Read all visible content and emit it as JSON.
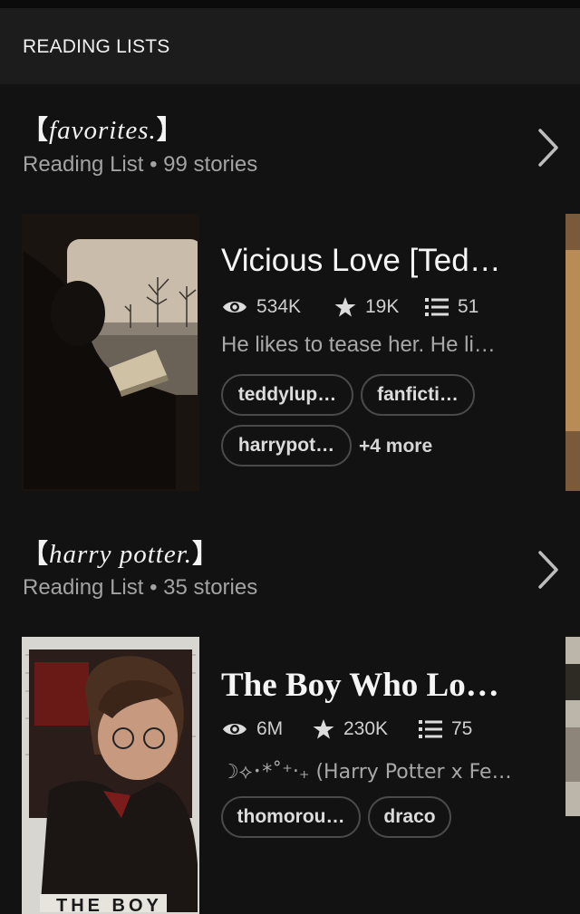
{
  "header": {
    "title": "READING LISTS"
  },
  "lists": [
    {
      "title_text": "favorites.",
      "title_open": "【",
      "title_close": "】",
      "meta": "Reading List • 99 stories",
      "story": {
        "title": "Vicious Love [Ted…",
        "views": "534K",
        "votes": "19K",
        "parts": "51",
        "description": "He likes to tease her. He li…",
        "tags": [
          "teddylup…",
          "fanficti…",
          "harrypot…"
        ],
        "more": "+4 more"
      }
    },
    {
      "title_text": "harry potter.",
      "title_open": "【",
      "title_close": "】",
      "meta": "Reading List • 35 stories",
      "story": {
        "title": "The Boy Who Lo…",
        "views": "6M",
        "votes": "230K",
        "parts": "75",
        "description": "☽⟡･*˚⁺‧₊ (Harry Potter x Fe…",
        "tags": [
          "thomorou…",
          "draco"
        ],
        "cover_text": "THE BOY"
      }
    }
  ],
  "icons": [
    "eye-icon",
    "star-icon",
    "list-icon",
    "chevron-right-icon"
  ],
  "colors": {
    "background": "#121212",
    "header": "#1c1c1c",
    "text": "#f5f5f5",
    "muted": "#a3a3a3",
    "tag_border": "#4a4a4a"
  }
}
